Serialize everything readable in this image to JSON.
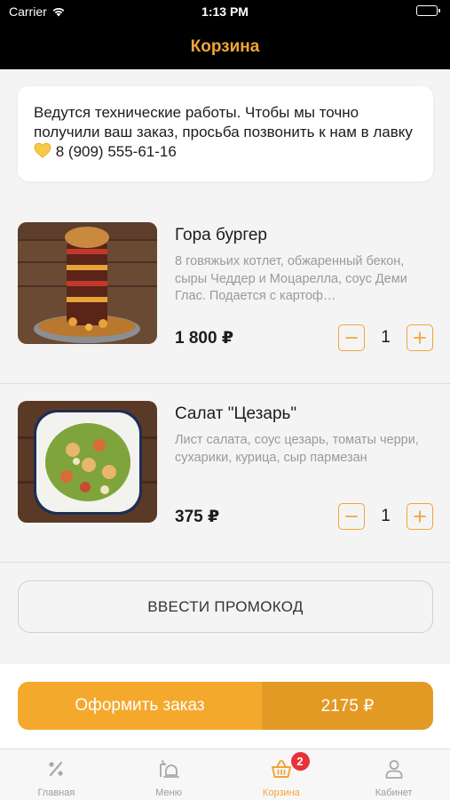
{
  "status_bar": {
    "carrier": "Carrier",
    "time": "1:13 PM"
  },
  "nav": {
    "title": "Корзина"
  },
  "notice": {
    "text": "Ведутся технические работы. Чтобы мы точно получили ваш заказ, просьба позвонить к нам в лавку",
    "phone": "8 (909) 555-61-16"
  },
  "cart": {
    "items": [
      {
        "name": "Гора бургер",
        "description": "8 говяжьих котлет, обжаренный бекон, сыры Чеддер и Моцарелла, соус Деми Глас. Подается с картоф…",
        "price": "1 800 ₽",
        "quantity": "1"
      },
      {
        "name": "Салат \"Цезарь\"",
        "description": "Лист салата, соус цезарь, томаты черри, сухарики, курица, сыр пармезан",
        "price": "375 ₽",
        "quantity": "1"
      }
    ]
  },
  "promo": {
    "label": "ВВЕСТИ ПРОМОКОД"
  },
  "checkout": {
    "label": "Оформить заказ",
    "total": "2175 ₽"
  },
  "tabbar": {
    "tabs": [
      {
        "label": "Главная",
        "icon": "percent-icon"
      },
      {
        "label": "Меню",
        "icon": "menu-icon"
      },
      {
        "label": "Корзина",
        "icon": "basket-icon",
        "badge": "2",
        "active": true
      },
      {
        "label": "Кабинет",
        "icon": "user-icon"
      }
    ]
  },
  "colors": {
    "accent": "#f2a536",
    "accent_dark": "#e39a25",
    "badge": "#e8323a",
    "navbar": "#000000"
  }
}
